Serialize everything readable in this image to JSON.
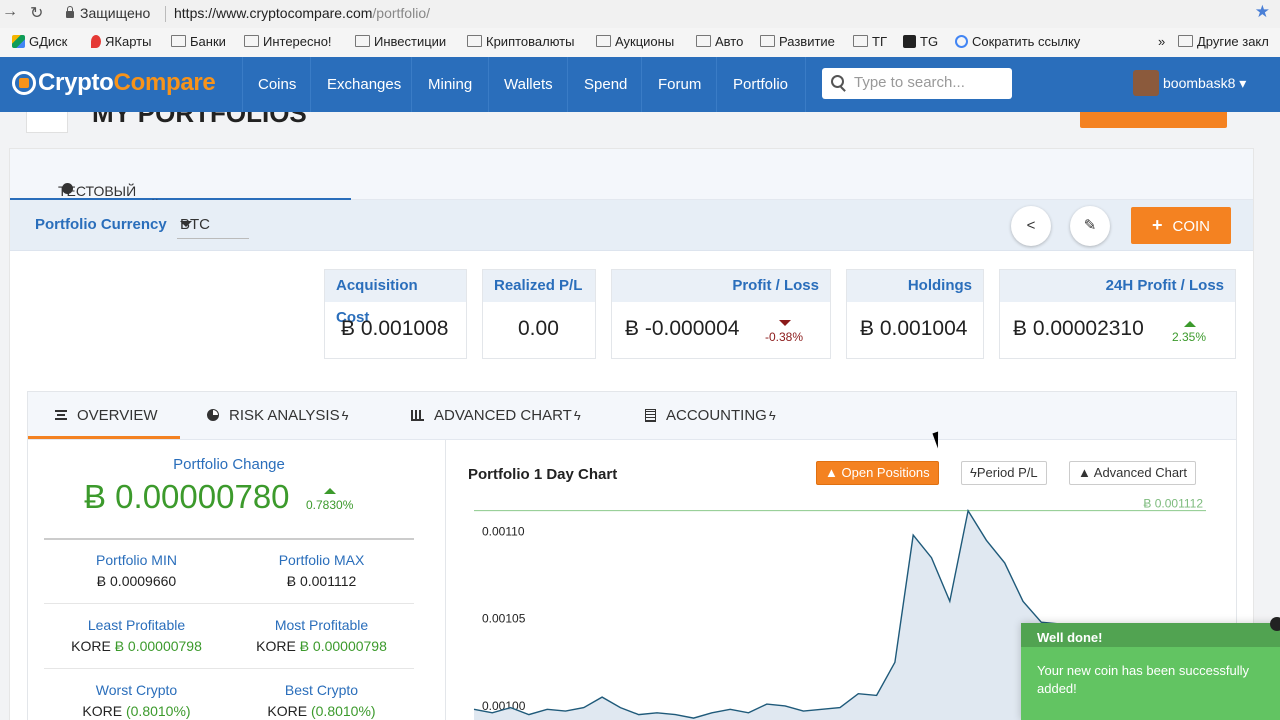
{
  "browser": {
    "secure_label": "Защищено",
    "url_base": "https://www.cryptocompare.com",
    "url_path": "/portfolio/"
  },
  "bookmarks": [
    {
      "label": "GДиск",
      "icon": "google-drive-icon"
    },
    {
      "label": "ЯКарты",
      "icon": "map-pin-icon"
    },
    {
      "label": "Банки",
      "icon": "folder-icon"
    },
    {
      "label": "Интересно!",
      "icon": "folder-icon"
    },
    {
      "label": "Инвестиции",
      "icon": "folder-icon"
    },
    {
      "label": "Криптовалюты",
      "icon": "folder-icon"
    },
    {
      "label": "Аукционы",
      "icon": "folder-icon"
    },
    {
      "label": "Авто",
      "icon": "folder-icon"
    },
    {
      "label": "Развитие",
      "icon": "folder-icon"
    },
    {
      "label": "ТГ",
      "icon": "folder-icon"
    },
    {
      "label": "TG",
      "icon": "t-icon"
    },
    {
      "label": "Сократить ссылку",
      "icon": "google-icon"
    },
    {
      "label": "»",
      "icon": ""
    },
    {
      "label": "Другие закл",
      "icon": "folder-icon"
    }
  ],
  "site": {
    "logo_part1": "Crypto",
    "logo_part2": "Compare",
    "nav": [
      "Coins",
      "Exchanges",
      "Mining",
      "Wallets",
      "Spend",
      "Forum",
      "Portfolio"
    ],
    "search_placeholder": "Type to search...",
    "username": "boombask8",
    "brand_color": "#2a6ebb",
    "accent_color": "#f48221"
  },
  "page": {
    "title": "MY PORTFOLIOS",
    "portfolio_tab": "ТЕСТОВЫЙ ПРИБЫЛЬНЫЙ ПОРТФЕЛЬ",
    "currency_label": "Portfolio Currency",
    "currency_value": "BTC",
    "coin_button": "COIN"
  },
  "stats": [
    {
      "label": "Acquisition Cost",
      "value": "Ƀ 0.001008",
      "pct": "",
      "tone": "neutral"
    },
    {
      "label": "Realized P/L",
      "value": "0.00",
      "pct": "",
      "tone": "green"
    },
    {
      "label": "Profit / Loss",
      "value": "Ƀ -0.000004",
      "pct": "-0.38%",
      "tone": "red"
    },
    {
      "label": "Holdings",
      "value": "Ƀ 0.001004",
      "pct": "",
      "tone": "neutral"
    },
    {
      "label": "24H Profit / Loss",
      "value": "Ƀ 0.00002310",
      "pct": "2.35%",
      "tone": "green"
    }
  ],
  "tabs": [
    {
      "label": "OVERVIEW",
      "icon": "list-icon",
      "bolt": false
    },
    {
      "label": "RISK ANALYSIS",
      "icon": "pie-chart-icon",
      "bolt": true
    },
    {
      "label": "ADVANCED CHART",
      "icon": "bar-chart-icon",
      "bolt": true
    },
    {
      "label": "ACCOUNTING",
      "icon": "calculator-icon",
      "bolt": true
    }
  ],
  "overview": {
    "change_label": "Portfolio Change",
    "change_value": "Ƀ 0.00000780",
    "change_pct": "0.7830%",
    "min_label": "Portfolio MIN",
    "min_value": "Ƀ 0.0009660",
    "max_label": "Portfolio MAX",
    "max_value": "Ƀ 0.001112",
    "least_label": "Least Profitable",
    "least_coin": "KORE",
    "least_value": "Ƀ 0.00000798",
    "most_label": "Most Profitable",
    "most_coin": "KORE",
    "most_value": "Ƀ 0.00000798",
    "worst_label": "Worst Crypto",
    "worst_coin": "KORE",
    "worst_value": "(0.8010%)",
    "best_label": "Best Crypto",
    "best_coin": "KORE",
    "best_value": "(0.8010%)"
  },
  "chart": {
    "title": "Portfolio 1 Day Chart",
    "btn_open": "Open Positions",
    "btn_period": "Period P/L",
    "btn_advanced": "Advanced Chart",
    "max_label": "Ƀ 0.001112"
  },
  "chart_data": {
    "type": "area",
    "title": "Portfolio 1 Day Chart",
    "xlabel": "",
    "ylabel": "",
    "ylim": [
      0.000985,
      0.001125
    ],
    "yticks": [
      "0.00110",
      "0.00105",
      "0.00100"
    ],
    "max_line": 0.001112,
    "values": [
      0.000998,
      0.000996,
      0.000999,
      0.000995,
      0.000998,
      0.000997,
      0.000999,
      0.001005,
      0.000999,
      0.000995,
      0.000996,
      0.000995,
      0.000993,
      0.000996,
      0.000998,
      0.000996,
      0.001001,
      0.001,
      0.000997,
      0.000998,
      0.000999,
      0.001007,
      0.001006,
      0.001025,
      0.001098,
      0.001085,
      0.00106,
      0.001112,
      0.001095,
      0.001082,
      0.00106,
      0.001048,
      0.001047,
      0.001046,
      0.001038,
      0.001031,
      0.001012,
      0.000995,
      0.00099,
      0.000988,
      0.000992
    ]
  },
  "toast": {
    "title": "Well done!",
    "message": "Your new coin has been successfully added!"
  }
}
